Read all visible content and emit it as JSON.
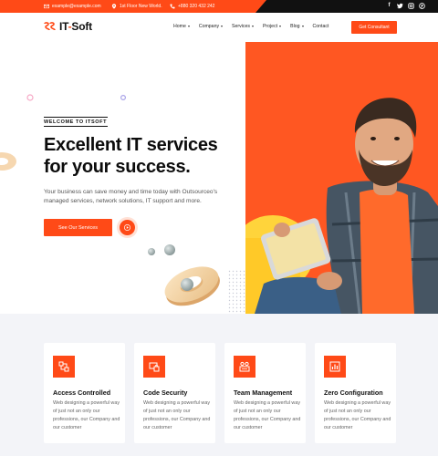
{
  "topbar": {
    "email": "example@example.com",
    "address": "1st Floor New World.",
    "phone": "+880 320 432 242",
    "social": [
      "facebook-icon",
      "twitter-icon",
      "instagram-icon",
      "pinterest-icon"
    ]
  },
  "header": {
    "logo": {
      "prefix": "IT",
      "dash": "-",
      "suffix": "Soft"
    },
    "nav": [
      {
        "label": "Home",
        "has_dropdown": true
      },
      {
        "label": "Company",
        "has_dropdown": true
      },
      {
        "label": "Services",
        "has_dropdown": true
      },
      {
        "label": "Project",
        "has_dropdown": true
      },
      {
        "label": "Blog",
        "has_dropdown": true
      },
      {
        "label": "Contact",
        "has_dropdown": false
      }
    ],
    "cta": "Get Consultant"
  },
  "hero": {
    "eyebrow": "WELCOME TO ITSOFT",
    "title_line1": "Excellent IT services",
    "title_line2": "for your success.",
    "description": "Your business can save money and time today with Outsourceo's managed services, network solutions, IT support and more.",
    "button": "See Our Services"
  },
  "features": [
    {
      "icon": "access-icon",
      "title": "Access Controlled",
      "desc": "Web designing a powerful way of just not an only our professions, our Company and our customer"
    },
    {
      "icon": "security-icon",
      "title": "Code Security",
      "desc": "Web designing a powerful way of just not an only our professions, our Company and our customer"
    },
    {
      "icon": "team-icon",
      "title": "Team Management",
      "desc": "Web designing a powerful way of just not an only our professions, our Company and our customer"
    },
    {
      "icon": "config-icon",
      "title": "Zero Configuration",
      "desc": "Web designing a powerful way of just not an only our professions, our Company and our customer"
    }
  ],
  "colors": {
    "accent": "#ff4a17",
    "dark": "#111111",
    "section_bg": "#f3f4f8"
  }
}
